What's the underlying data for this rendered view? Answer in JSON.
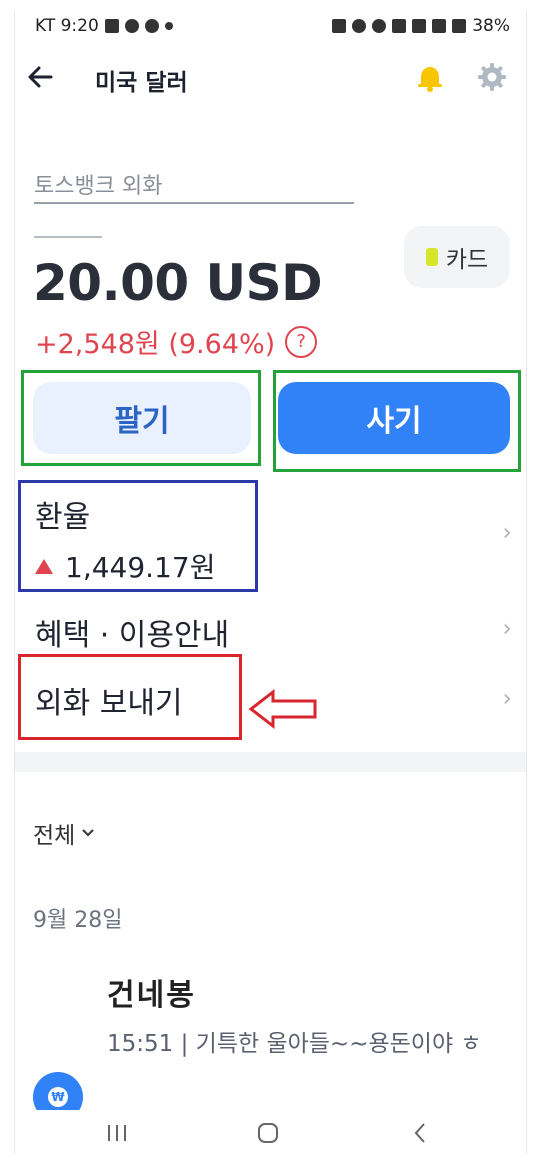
{
  "status_bar": {
    "carrier_time": "KT 9:20",
    "battery": "38%"
  },
  "header": {
    "title": "미국 달러"
  },
  "account": {
    "name": "토스뱅크 외화 ",
    "card_label": "카드",
    "balance": "20.00 USD",
    "change": "+2,548원 (9.64%)",
    "help": "?"
  },
  "actions": {
    "sell_label": "팔기",
    "buy_label": "사기"
  },
  "menu": {
    "exchange_rate_title": "환율",
    "exchange_rate_value": "1,449.17원",
    "benefits_label": "혜택 · 이용안내",
    "send_foreign_label": "외화 보내기",
    "chevron": "›"
  },
  "transactions": {
    "filter_label": "전체",
    "date": "9월 28일",
    "items": [
      {
        "name": "건네봉",
        "memo": "15:51 | 기특한 울아들~~용돈이야 ㅎ",
        "icon_symbol": "₩"
      }
    ]
  },
  "colors": {
    "accent": "#3182f6",
    "up_red": "#e0454f",
    "highlight_green": "#24a33a",
    "highlight_blue": "#2b3aa8",
    "highlight_red": "#d9262c"
  }
}
